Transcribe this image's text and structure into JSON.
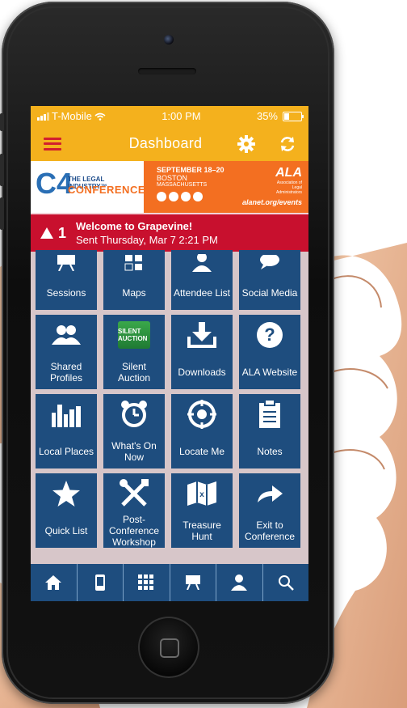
{
  "status_bar": {
    "carrier": "T-Mobile",
    "time": "1:00 PM",
    "battery": "35%"
  },
  "header": {
    "title": "Dashboard"
  },
  "banner": {
    "logo_mark": "C4",
    "line1": "THE LEGAL INDUSTRY™",
    "line2": "CONFERENCE",
    "dates": "SEPTEMBER 18–20",
    "city": "BOSTON",
    "state": "MASSACHUSETTS",
    "org": "ALA",
    "org_sub": "Association of Legal Administrators",
    "url": "alanet.org/events"
  },
  "alert": {
    "count": "1",
    "title": "Welcome to Grapevine!",
    "subtitle": "Sent Thursday, Mar 7 2:21 PM"
  },
  "tiles": [
    {
      "label": "Sessions",
      "icon": "presentation-board-icon"
    },
    {
      "label": "Maps",
      "icon": "map-grid-icon"
    },
    {
      "label": "Attendee List",
      "icon": "person-icon"
    },
    {
      "label": "Social Media",
      "icon": "chat-bubble-icon"
    },
    {
      "label": "Shared Profiles",
      "icon": "people-icon"
    },
    {
      "label": "Silent Auction",
      "icon": "silent-auction-icon",
      "badge": "SILENT AUCTION"
    },
    {
      "label": "Downloads",
      "icon": "download-icon"
    },
    {
      "label": "ALA Website",
      "icon": "question-icon"
    },
    {
      "label": "Local Places",
      "icon": "city-skyline-icon"
    },
    {
      "label": "What's On Now",
      "icon": "alarm-clock-icon"
    },
    {
      "label": "Locate Me",
      "icon": "target-icon"
    },
    {
      "label": "Notes",
      "icon": "clipboard-icon"
    },
    {
      "label": "Quick List",
      "icon": "star-icon"
    },
    {
      "label": "Post-Conference Workshop",
      "icon": "tools-icon"
    },
    {
      "label": "Treasure Hunt",
      "icon": "treasure-map-icon"
    },
    {
      "label": "Exit to Conference",
      "icon": "arrow-right-icon"
    }
  ],
  "tab_bar": [
    "home-icon",
    "phone-icon",
    "grid-icon",
    "presentation-icon",
    "person-badge-icon",
    "search-icon"
  ],
  "colors": {
    "header": "#f4b11d",
    "tile": "#1e4d7e",
    "alert": "#c8102e",
    "banner_orange": "#f36f21",
    "menu_icon": "#d11f2e"
  }
}
